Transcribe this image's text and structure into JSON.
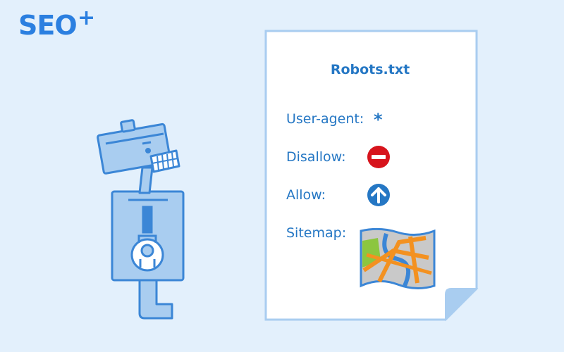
{
  "logo": {
    "text": "SEO",
    "superscript": "+"
  },
  "document": {
    "title": "Robots.txt",
    "rows": [
      {
        "label": "User-agent:",
        "value": "*"
      },
      {
        "label": "Disallow:",
        "icon": "no-entry-icon"
      },
      {
        "label": "Allow:",
        "icon": "up-arrow-icon"
      },
      {
        "label": "Sitemap:",
        "icon": "map-icon"
      }
    ]
  },
  "illustration": {
    "character": "robot-icon"
  },
  "colors": {
    "background": "#e3f0fc",
    "brand_blue": "#2b7fe0",
    "text_blue": "#2577c4",
    "stroke_blue": "#3b86d6",
    "fill_light_blue": "#a9cdf0",
    "disallow_red": "#d7141c",
    "map_orange": "#f39120",
    "map_green": "#8cc63f"
  }
}
